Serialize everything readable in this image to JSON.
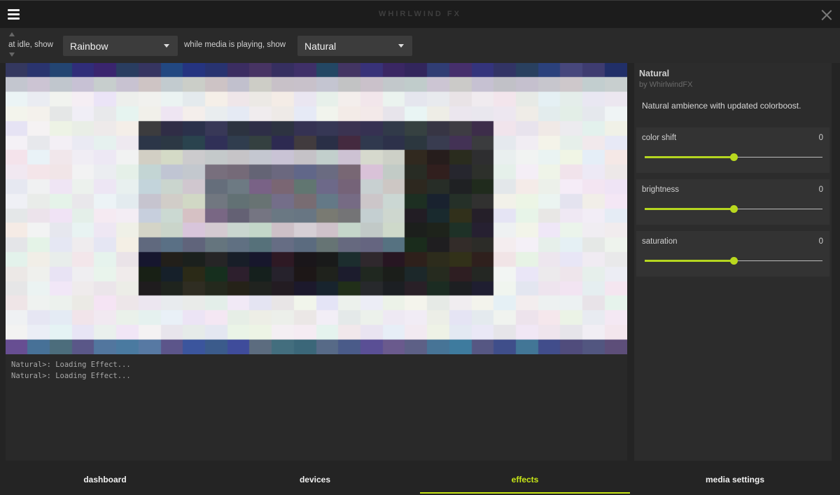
{
  "window": {
    "title": "WHIRLWIND FX",
    "menu_icon": "hamburger-icon",
    "close_icon": "close-icon"
  },
  "toolbar": {
    "idle_label": "at idle, show",
    "idle_value": "Rainbow",
    "playing_label": "while media is playing, show",
    "playing_value": "Natural"
  },
  "console": {
    "lines": [
      "Natural>: Loading Effect...",
      "Natural>: Loading Effect..."
    ]
  },
  "effect": {
    "name": "Natural",
    "author": "by WhirlwindFX",
    "description": "Natural ambience with updated colorboost."
  },
  "sliders": [
    {
      "label": "color shift",
      "value": "0",
      "level": 0.5
    },
    {
      "label": "brightness",
      "value": "0",
      "level": 0.5
    },
    {
      "label": "saturation",
      "value": "0",
      "level": 0.5
    }
  ],
  "nav": {
    "tabs": [
      {
        "label": "dashboard"
      },
      {
        "label": "devices"
      },
      {
        "label": "effects"
      },
      {
        "label": "media settings"
      }
    ],
    "active": "effects"
  },
  "colors": {
    "accent": "#c7e617",
    "background": "#242424",
    "panel": "#2c2c2c"
  }
}
